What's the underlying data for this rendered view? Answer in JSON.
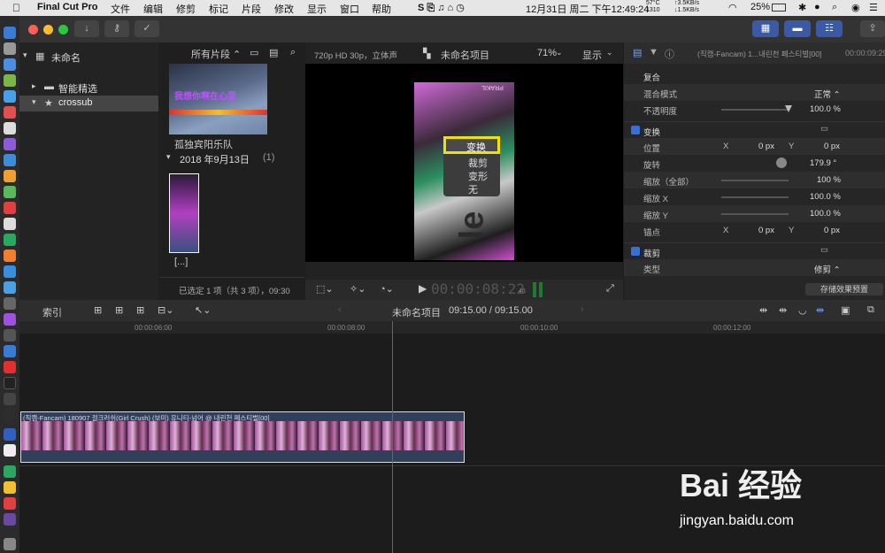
{
  "menubar": {
    "app": "Final Cut Pro",
    "items": [
      "文件",
      "编辑",
      "修剪",
      "标记",
      "片段",
      "修改",
      "显示",
      "窗口",
      "帮助"
    ],
    "temp": "57°C",
    "fan": "1310",
    "net_up": "↑3.5KB/s",
    "net_down": "↓1.5KB/s",
    "battery": "25%",
    "datetime": "12月31日 周二 下午12:49:24"
  },
  "library": {
    "root": "未命名",
    "items": [
      "智能精选",
      "crossub"
    ]
  },
  "browser": {
    "filter": "所有片段 ⌃",
    "clip1_title": "孤独宾阳乐队",
    "thumb_text": "我想你啊在心里",
    "date_group": "2018 年9月13日",
    "date_count": "(1)",
    "clip2_title": "[...]",
    "status": "已选定 1 项（共 3 项），09:30"
  },
  "viewer": {
    "format": "720p HD 30p，立体声",
    "project": "未命名项目",
    "zoom": "71%",
    "display": "显示",
    "menu_items": [
      "变换",
      "裁剪",
      "变形",
      "无"
    ],
    "timecode": "00:00:08:22",
    "frames": "46",
    "watermark": "PRAKIL",
    "bg_text": "le"
  },
  "inspector": {
    "title": "(직캠-Fancam) 1...내린천 페스티벌[00]",
    "duration": "00:00:09:29",
    "composite": "复合",
    "blend_label": "混合模式",
    "blend_value": "正常 ⌃",
    "opacity_label": "不透明度",
    "opacity_value": "100.0 %",
    "opacity_level": 1.0,
    "transform": "变换",
    "position": "位置",
    "pos_x_label": "X",
    "pos_x": "0 px",
    "pos_y_label": "Y",
    "pos_y": "0 px",
    "rotation": "旋转",
    "rotation_value": "179.9 °",
    "scale_all": "缩放（全部）",
    "scale_all_value": "100 %",
    "scale_x": "缩放 X",
    "scale_x_value": "100.0 %",
    "scale_y": "缩放 Y",
    "scale_y_value": "100.0 %",
    "anchor": "锚点",
    "anchor_x_label": "X",
    "anchor_x": "0 px",
    "anchor_y_label": "Y",
    "anchor_y": "0 px",
    "crop": "裁剪",
    "crop_type": "类型",
    "crop_type_value": "修剪 ⌃",
    "save_preset": "存储效果预置"
  },
  "timeline": {
    "index": "索引",
    "project": "未命名项目",
    "time": "09:15.00 / 09:15.00",
    "ruler": [
      "00:00:06:00",
      "00:00:08:00",
      "00:00:10:00",
      "00:00:12:00"
    ],
    "clip_title": "(직캠-Fancam) 180907 걸크러쉬(Girl Crush) (보미) 유니티-넘어 @ 내린천 페스티벌[00]"
  },
  "watermark": {
    "brand": "Bai 经验",
    "url": "jingyan.baidu.com"
  }
}
